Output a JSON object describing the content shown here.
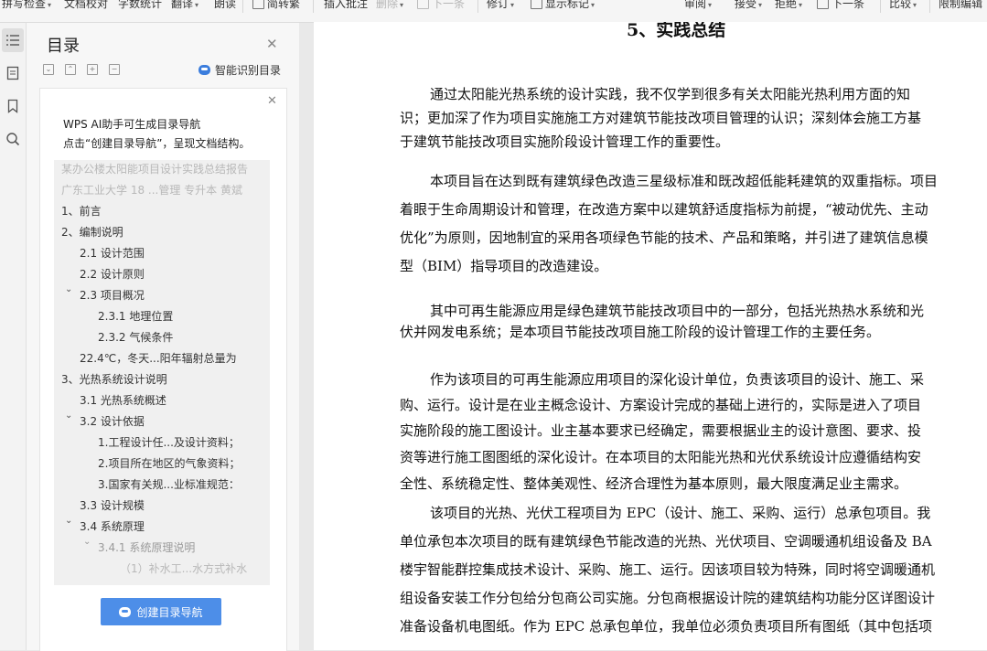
{
  "toolbar": {
    "items": [
      "拼写检查",
      "文档校对",
      "字数统计",
      "翻译",
      "朗读",
      "简转繁",
      "插入批注",
      "删除",
      "下一条",
      "修订",
      "显示标记",
      "审阅",
      "接受",
      "拒绝",
      "下一条",
      "比较",
      "限制编辑"
    ]
  },
  "toc": {
    "title": "目录",
    "smart_label": "智能识别目录",
    "hint_line1": "WPS AI助手可生成目录导航",
    "hint_line2": "点击“创建目录导航”，呈现文档结构。",
    "items": [
      "某办公楼太阳能项目设计实践总结报告",
      "广东工业大学 18 ...管理 专升本 黄斌",
      "1、前言",
      "2、编制说明",
      "2.1 设计范围",
      "2.2 设计原则",
      "2.3 项目概况",
      "2.3.1 地理位置",
      "2.3.2 气候条件",
      "22.4℃，冬天...阳年辐射总量为",
      "3、光热系统设计说明",
      "3.1 光热系统概述",
      "3.2 设计依据",
      "1.工程设计任...及设计资料；",
      "2.项目所在地区的气象资料；",
      "3.国家有关规...业标准规范：",
      "3.3 设计规模",
      "3.4 系统原理",
      "3.4.1 系统原理说明",
      "（1）补水工...水方式补水"
    ],
    "create_button": "创建目录导航"
  },
  "document": {
    "heading": "5、实践总结",
    "paragraphs": [
      [
        "通过太阳能光热系统的设计实践，我不仅学到很多有关太阳能光热利用方面的知",
        "识；更加深了作为项目实施施工方对建筑节能技改项目管理的认识；深刻体会施工方基",
        "于建筑节能技改项目实施阶段设计管理工作的重要性。"
      ],
      [
        "本项目旨在达到既有建筑绿色改造三星级标准和既改超低能耗建筑的双重指标。项目",
        "着眼于生命周期设计和管理，在改造方案中以建筑舒适度指标为前提，“被动优先、主动",
        "优化”为原则，因地制宜的采用各项绿色节能的技术、产品和策略，并引进了建筑信息模",
        "型（BIM）指导项目的改造建设。"
      ],
      [
        "其中可再生能源应用是绿色建筑节能技改项目中的一部分，包括光热热水系统和光",
        "伏并网发电系统；是本项目节能技改项目施工阶段的设计管理工作的主要任务。"
      ],
      [
        "作为该项目的可再生能源应用项目的深化设计单位，负责该项目的设计、施工、采",
        "购、运行。设计是在业主概念设计、方案设计完成的基础上进行的，实际是进入了项目",
        "实施阶段的施工图设计。业主基本要求已经确定，需要根据业主的设计意图、要求、投",
        "资等进行施工图图纸的深化设计。在本项目的太阳能光热和光伏系统设计应遵循结构安",
        "全性、系统稳定性、整体美观性、经济合理性为基本原则，最大限度满足业主需求。"
      ],
      [
        "该项目的光热、光伏工程项目为 EPC（设计、施工、采购、运行）总承包项目。我",
        "单位承包本次项目的既有建筑绿色节能改造的光热、光伏项目、空调暖通机组设备及 BA",
        "楼宇智能群控集成技术设计、采购、施工、运行。因该项目较为特殊，同时将空调暖通机",
        "组设备安装工作分包给分包商公司实施。分包商根据设计院的建筑结构功能分区详图设计",
        "准备设备机电图纸。作为 EPC 总承包单位，我单位必须负责项目所有图纸（其中包括项"
      ]
    ]
  }
}
